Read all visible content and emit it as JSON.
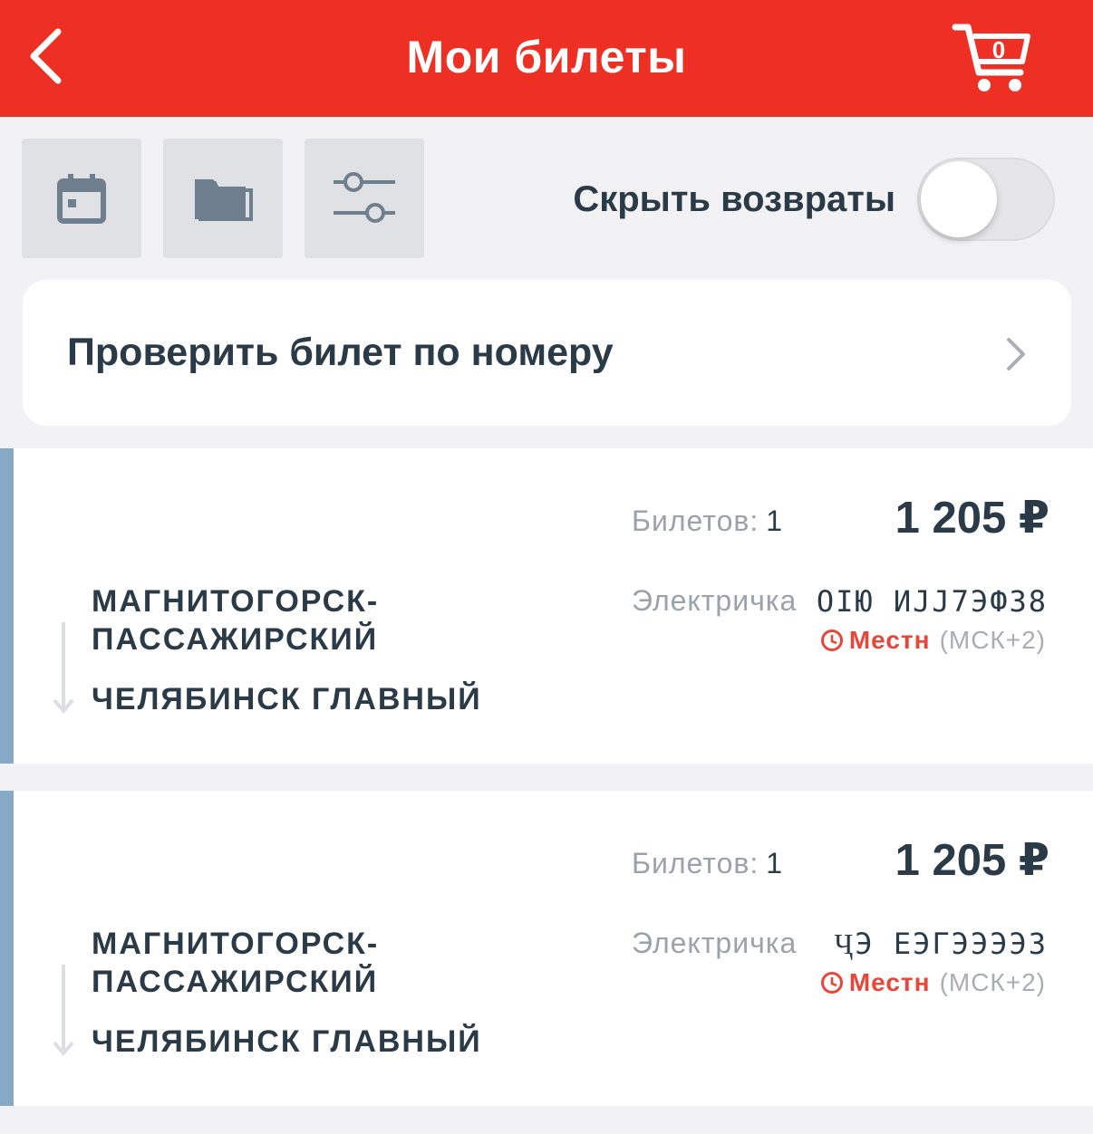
{
  "header": {
    "title": "Мои билеты",
    "cart_count": "0"
  },
  "toolbar": {
    "buttons": [
      "calendar-icon",
      "folder-icon",
      "sliders-icon"
    ],
    "hide_returns_label": "Скрыть возвраты",
    "hide_returns_on": false
  },
  "check_ticket": {
    "label": "Проверить билет по номеру"
  },
  "tickets": [
    {
      "count_label": "Билетов:",
      "count": "1",
      "price": "1 205 ₽",
      "from": "МАГНИТОГОРСК-ПАССАЖИРСКИЙ",
      "to": "ЧЕЛЯБИНСК ГЛАВНЫЙ",
      "train_type": "Электричка",
      "train_number": "ОІЮ ИЈЈ7ЭФ38",
      "time_local": "Местн",
      "time_zone": "(МСК+2)"
    },
    {
      "count_label": "Билетов:",
      "count": "1",
      "price": "1 205 ₽",
      "from": "МАГНИТОГОРСК-ПАССАЖИРСКИЙ",
      "to": "ЧЕЛЯБИНСК ГЛАВНЫЙ",
      "train_type": "Электричка",
      "train_number": "ҶЭ ЕЭГЭЭЭЭЗ",
      "time_local": "Местн",
      "time_zone": "(МСК+2)"
    }
  ],
  "colors": {
    "header": "#ee3024",
    "accent_stripe": "#85a9c6",
    "text": "#2b3a47",
    "muted": "#9aa2aa",
    "local_time": "#e8463a"
  }
}
